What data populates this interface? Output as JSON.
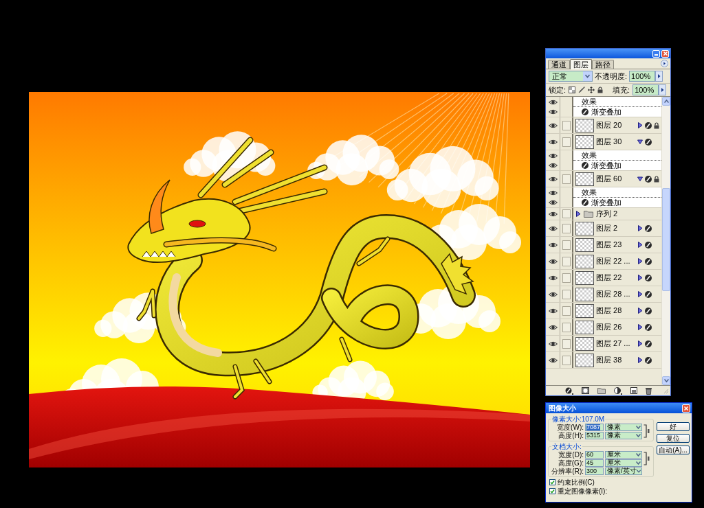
{
  "layers_panel": {
    "tabs": [
      {
        "label": "通道",
        "selected": false
      },
      {
        "label": "图层",
        "selected": true
      },
      {
        "label": "路径",
        "selected": false
      }
    ],
    "blend_mode": "正常",
    "opacity_label": "不透明度:",
    "opacity": "100%",
    "lock_label": "锁定:",
    "fill_label": "填充:",
    "fill": "100%",
    "layers": [
      {
        "kind": "effects_header",
        "label": "效果",
        "visible": true
      },
      {
        "kind": "effect",
        "label": "渐变叠加",
        "visible": true
      },
      {
        "kind": "layer",
        "label": "图层 20",
        "visible": true,
        "expanded": false,
        "effects": true,
        "locked": true
      },
      {
        "kind": "layer",
        "label": "图层 30",
        "visible": true,
        "expanded": true,
        "effects": true,
        "locked": false
      },
      {
        "kind": "effects_header",
        "label": "效果",
        "visible": true
      },
      {
        "kind": "effect",
        "label": "渐变叠加",
        "visible": true
      },
      {
        "kind": "layer",
        "label": "图层 60",
        "visible": true,
        "expanded": true,
        "effects": true,
        "locked": true
      },
      {
        "kind": "effects_header",
        "label": "效果",
        "visible": true
      },
      {
        "kind": "effect",
        "label": "渐变叠加",
        "visible": true
      },
      {
        "kind": "group",
        "label": "序列 2",
        "visible": true,
        "expanded": false
      },
      {
        "kind": "layer",
        "label": "图层 2",
        "visible": true,
        "expanded": false,
        "effects": true,
        "locked": false
      },
      {
        "kind": "layer",
        "label": "图层 23",
        "visible": true,
        "expanded": false,
        "effects": true,
        "locked": false
      },
      {
        "kind": "layer",
        "label": "图层 22 ...",
        "visible": true,
        "expanded": false,
        "effects": true,
        "locked": false
      },
      {
        "kind": "layer",
        "label": "图层 22",
        "visible": true,
        "expanded": false,
        "effects": true,
        "locked": false
      },
      {
        "kind": "layer",
        "label": "图层 28 ...",
        "visible": true,
        "expanded": false,
        "effects": true,
        "locked": false
      },
      {
        "kind": "layer",
        "label": "图层 28",
        "visible": true,
        "expanded": false,
        "effects": true,
        "locked": false
      },
      {
        "kind": "layer",
        "label": "图层 26",
        "visible": true,
        "expanded": false,
        "effects": true,
        "locked": false
      },
      {
        "kind": "layer",
        "label": "图层 27 ...",
        "visible": true,
        "expanded": false,
        "effects": true,
        "locked": false
      },
      {
        "kind": "layer",
        "label": "图层 38",
        "visible": true,
        "expanded": false,
        "effects": true,
        "locked": false
      }
    ]
  },
  "image_size_dialog": {
    "title": "图像大小",
    "pixel_dimensions": {
      "label": "像素大小:107.0M",
      "fields": [
        {
          "label": "宽度(W):",
          "value": "7087",
          "unit": "像素",
          "selected": true
        },
        {
          "label": "高度(H):",
          "value": "5315",
          "unit": "像素",
          "selected": false
        }
      ]
    },
    "document_size": {
      "label": "文档大小:",
      "fields": [
        {
          "label": "宽度(D):",
          "value": "60",
          "unit": "厘米",
          "selected": false
        },
        {
          "label": "高度(G):",
          "value": "45",
          "unit": "厘米",
          "selected": false
        },
        {
          "label": "分辨率(R):",
          "value": "300",
          "unit": "像素/英寸",
          "selected": false
        }
      ]
    },
    "buttons": [
      "好",
      "复位",
      "自动(A)..."
    ],
    "checkboxes": [
      {
        "label": "约束比例(C)",
        "checked": true
      },
      {
        "label": "重定图像像素(I):",
        "checked": true
      }
    ]
  }
}
